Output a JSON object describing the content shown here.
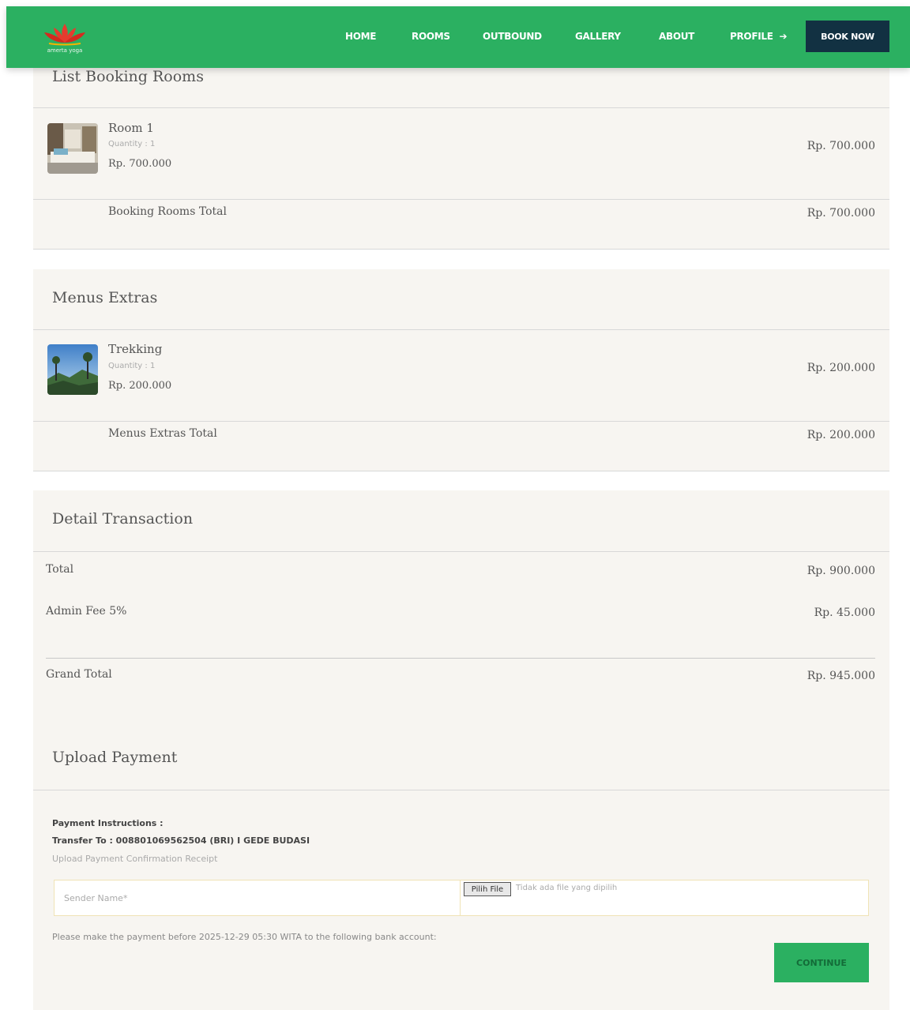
{
  "nav": {
    "logo_text": "amerta yoga",
    "links": [
      "HOME",
      "ROOMS",
      "OUTBOUND",
      "GALLERY",
      "ABOUT",
      "PROFILE"
    ],
    "book_label": "BOOK NOW"
  },
  "rooms": {
    "title": "List Booking Rooms",
    "item": {
      "name": "Room 1",
      "qty": "Quantity : 1",
      "price": "Rp. 700.000",
      "total": "Rp. 700.000"
    },
    "total_label": "Booking Rooms Total",
    "total_value": "Rp. 700.000"
  },
  "extras": {
    "title": "Menus Extras",
    "item": {
      "name": "Trekking",
      "qty": "Quantity : 1",
      "price": "Rp. 200.000",
      "total": "Rp. 200.000"
    },
    "total_label": "Menus Extras Total",
    "total_value": "Rp. 200.000"
  },
  "transaction": {
    "title": "Detail Transaction",
    "total_label": "Total",
    "total_value": "Rp. 900.000",
    "fee_label": "Admin Fee 5%",
    "fee_value": "Rp. 45.000",
    "grand_label": "Grand Total",
    "grand_value": "Rp. 945.000"
  },
  "upload": {
    "title": "Upload Payment",
    "instructions_label": "Payment Instructions :",
    "transfer_to": "Transfer To : 008801069562504 (BRI) I GEDE BUDASI",
    "upload_hint": "Upload Payment Confirmation Receipt",
    "sender_placeholder": "Sender Name*",
    "file_button": "Pilih File",
    "file_status": "Tidak ada file yang dipilih",
    "note": "Please make the payment before 2025-12-29 05:30 WITA to the following bank account:",
    "continue_label": "CONTINUE"
  },
  "colors": {
    "brand_green": "#2bb061",
    "book_button": "#123142",
    "card_bg": "#f7f5f1"
  }
}
